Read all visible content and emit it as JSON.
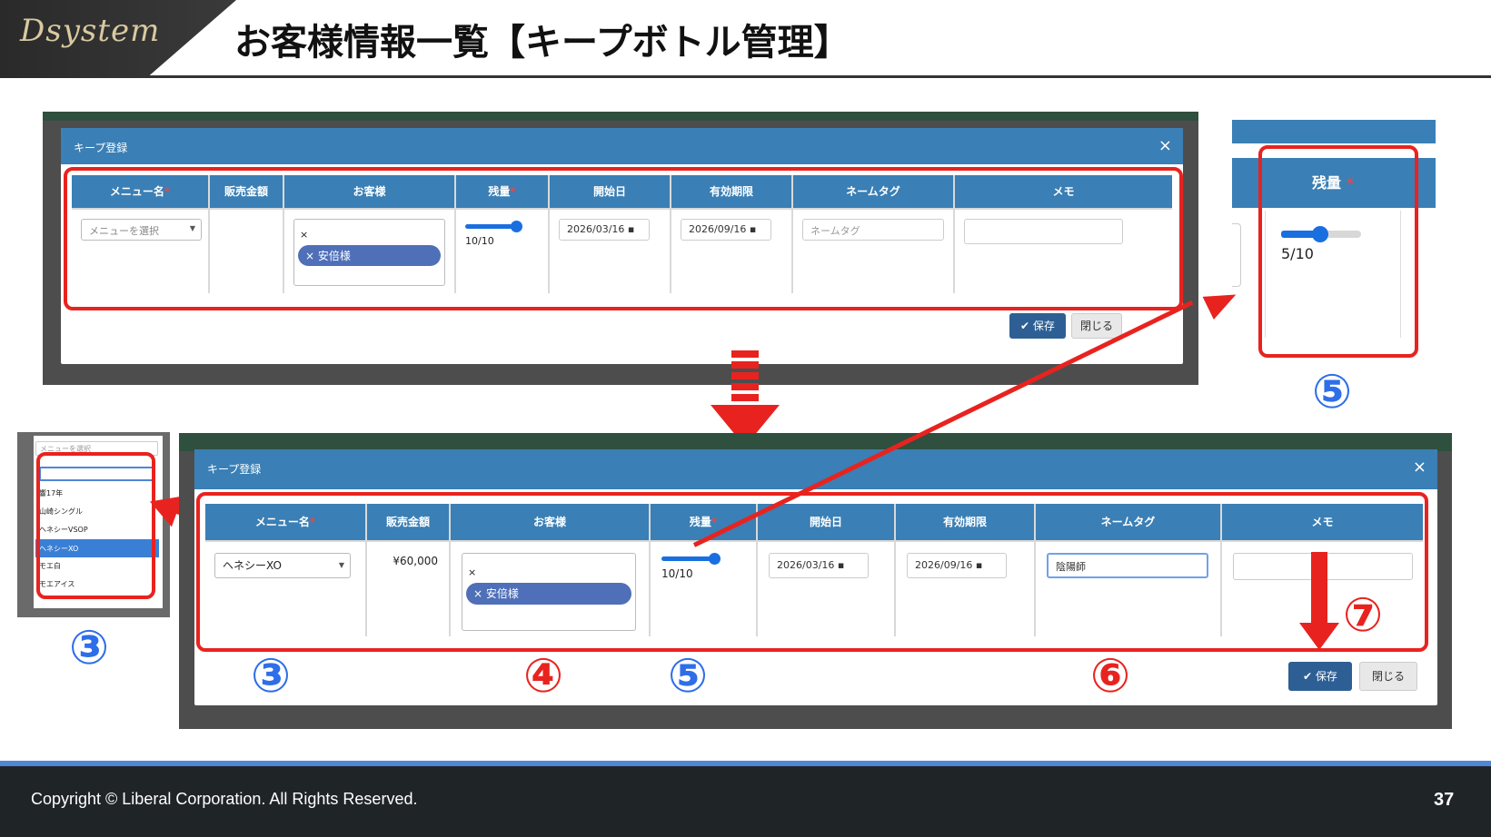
{
  "header": {
    "logo_text": "Dsystem",
    "title": "お客様情報一覧【キープボトル管理】"
  },
  "footer": {
    "copyright": "Copyright ©  Liberal Corporation. All Rights Reserved.",
    "page_number": "37"
  },
  "modal": {
    "title": "キープ登録",
    "close_symbol": "×",
    "columns": [
      "メニュー名",
      "販売金額",
      "お客様",
      "残量",
      "開始日",
      "有効期限",
      "ネームタグ",
      "メモ"
    ],
    "required_mark": "*",
    "save_label": "保存",
    "close_label": "閉じる"
  },
  "top_form": {
    "menu_placeholder": "メニューを選択",
    "price": "",
    "customer_tag": "× 安倍様",
    "customer_clear": "×",
    "remaining_text": "10/10",
    "remaining_value": 1.0,
    "start_date": "2026/03/16",
    "expiry_date": "2026/09/16",
    "nametag_placeholder": "ネームタグ",
    "save_label": "保存",
    "close_label": "閉じる"
  },
  "zoom_remaining": {
    "header": "残量",
    "required_mark": "*",
    "value_text": "5/10",
    "value": 0.5
  },
  "dropdown": {
    "selected": "メニューを選択",
    "options": [
      "響17年",
      "山崎シングル",
      "ヘネシーVSOP",
      "ヘネシーXO",
      "モエ白",
      "モエアイス"
    ],
    "highlighted": "ヘネシーXO"
  },
  "bottom_form": {
    "menu_value": "ヘネシーXO",
    "price": "¥60,000",
    "customer_tag": "× 安倍様",
    "customer_clear": "×",
    "remaining_text": "10/10",
    "remaining_value": 1.0,
    "start_date": "2026/03/16",
    "expiry_date": "2026/09/16",
    "nametag_value": "陰陽師",
    "save_label": "保存",
    "close_label": "閉じる"
  },
  "step_markers": {
    "s3": "③",
    "s4": "④",
    "s5": "⑤",
    "s6": "⑥",
    "s7": "⑦"
  },
  "colors": {
    "accent": "#3a7fb5",
    "highlight_red": "#e8231f",
    "marker_blue": "#2e6ee8"
  }
}
